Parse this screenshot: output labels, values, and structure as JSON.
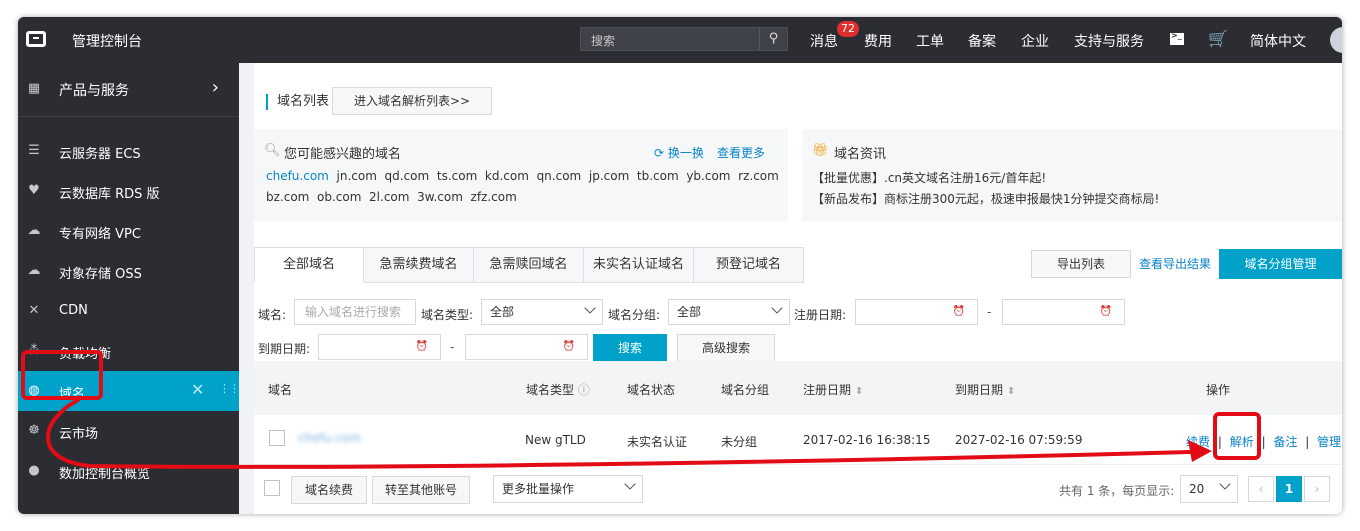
{
  "topbar": {
    "console_title": "管理控制台",
    "search_placeholder": "搜索",
    "messages_label": "消息",
    "messages_count": "72",
    "nav": [
      "费用",
      "工单",
      "备案",
      "企业",
      "支持与服务"
    ],
    "language_label": "简体中文"
  },
  "sidebar": {
    "header": "产品与服务",
    "items": [
      {
        "label": "云服务器 ECS",
        "icon": "server-icon"
      },
      {
        "label": "云数据库 RDS 版",
        "icon": "database-icon"
      },
      {
        "label": "专有网络 VPC",
        "icon": "cloud-network-icon"
      },
      {
        "label": "对象存储 OSS",
        "icon": "cloud-storage-icon"
      },
      {
        "label": "CDN",
        "icon": "cdn-icon"
      },
      {
        "label": "负载均衡",
        "icon": "load-balancer-icon"
      },
      {
        "label": "域名",
        "icon": "globe-icon",
        "active": true
      },
      {
        "label": "云市场",
        "icon": "market-icon"
      },
      {
        "label": "数加控制台概览",
        "icon": "circle-icon"
      }
    ]
  },
  "page": {
    "tab_label": "域名列表",
    "dns_list_button": "进入域名解析列表>>"
  },
  "suggest": {
    "title": "您可能感兴趣的域名",
    "refresh_label": "换一换",
    "more_label": "查看更多",
    "row1": [
      "chefu.com",
      "jn.com",
      "qd.com",
      "ts.com",
      "kd.com",
      "qn.com",
      "jp.com",
      "tb.com",
      "yb.com",
      "rz.com"
    ],
    "row2": [
      "bz.com",
      "ob.com",
      "2l.com",
      "3w.com",
      "zfz.com"
    ]
  },
  "news": {
    "title": "域名资讯",
    "lines": [
      "【批量优惠】.cn英文域名注册16元/首年起!",
      "【新品发布】商标注册300元起，极速申报最快1分钟提交商标局!"
    ]
  },
  "tabs": [
    "全部域名",
    "急需续费域名",
    "急需赎回域名",
    "未实名认证域名",
    "预登记域名"
  ],
  "actions": {
    "export_list": "导出列表",
    "view_export": "查看导出结果",
    "group_manage": "域名分组管理"
  },
  "filters": {
    "domain_label": "域名:",
    "domain_placeholder": "输入域名进行搜索",
    "type_label": "域名类型:",
    "type_value": "全部",
    "group_label": "域名分组:",
    "group_value": "全部",
    "reg_date_label": "注册日期:",
    "exp_date_label": "到期日期:",
    "dash": "-",
    "search_button": "搜索",
    "advanced_button": "高级搜索"
  },
  "table": {
    "headers": {
      "domain": "域名",
      "type": "域名类型",
      "status": "域名状态",
      "group": "域名分组",
      "reg_date": "注册日期",
      "exp_date": "到期日期",
      "ops": "操作"
    },
    "rows": [
      {
        "domain": "chefu.com",
        "type": "New gTLD",
        "status": "未实名认证",
        "group": "未分组",
        "reg_date": "2017-02-16 16:38:15",
        "exp_date": "2027-02-16 07:59:59",
        "ops": [
          "续费",
          "解析",
          "备注",
          "管理"
        ]
      }
    ]
  },
  "footer": {
    "renew_button": "域名续费",
    "transfer_button": "转至其他账号",
    "batch_select": "更多批量操作",
    "total_text": "共有 1 条，每页显示:",
    "page_size": "20",
    "current_page": "1"
  },
  "colors": {
    "accent": "#00a2ca",
    "topbar": "#2b2d33",
    "annotation": "#e20b16"
  }
}
